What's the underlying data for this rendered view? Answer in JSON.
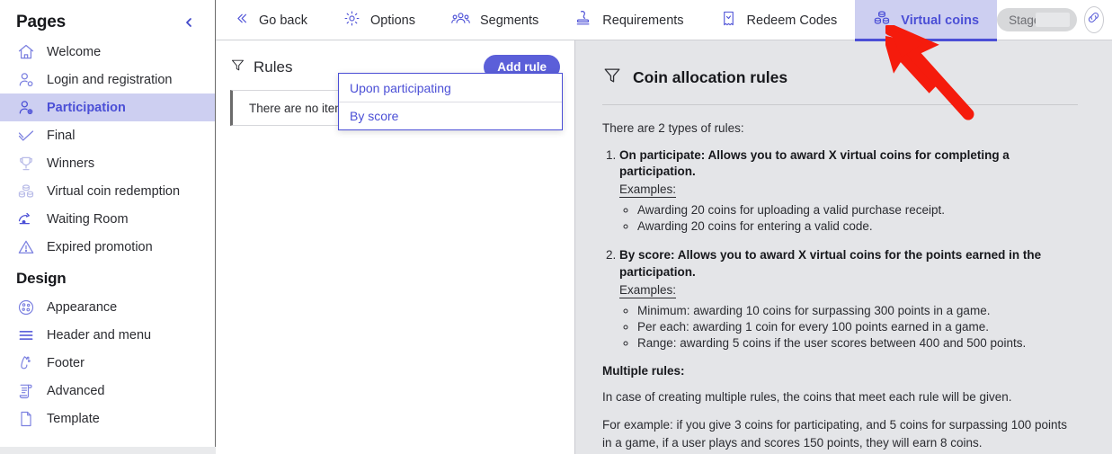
{
  "sidebar": {
    "title": "Pages",
    "collapse_icon": "chevron-left-icon",
    "pages": [
      {
        "label": "Welcome",
        "icon": "home-icon",
        "active": false
      },
      {
        "label": "Login and registration",
        "icon": "user-check-icon",
        "active": false
      },
      {
        "label": "Participation",
        "icon": "user-plus-icon",
        "active": true
      },
      {
        "label": "Final",
        "icon": "check-badge-icon",
        "active": false
      },
      {
        "label": "Winners",
        "icon": "trophy-icon",
        "active": false
      },
      {
        "label": "Virtual coin redemption",
        "icon": "coins-stack-icon",
        "active": false
      },
      {
        "label": "Waiting Room",
        "icon": "waiting-room-icon",
        "active": false
      },
      {
        "label": "Expired promotion",
        "icon": "warning-triangle-icon",
        "active": false
      }
    ],
    "design_title": "Design",
    "design": [
      {
        "label": "Appearance",
        "icon": "palette-icon"
      },
      {
        "label": "Header and menu",
        "icon": "menu-lines-icon"
      },
      {
        "label": "Footer",
        "icon": "footer-icon"
      },
      {
        "label": "Advanced",
        "icon": "scroll-document-icon"
      },
      {
        "label": "Template",
        "icon": "page-icon"
      }
    ]
  },
  "toolbar": {
    "items": [
      {
        "label": "Go back",
        "icon": "double-chevron-left-icon",
        "active": false
      },
      {
        "label": "Options",
        "icon": "gear-icon",
        "active": false
      },
      {
        "label": "Segments",
        "icon": "people-group-icon",
        "active": false
      },
      {
        "label": "Requirements",
        "icon": "stamp-icon",
        "active": false
      },
      {
        "label": "Redeem Codes",
        "icon": "ticket-icon",
        "active": false
      },
      {
        "label": "Virtual coins",
        "icon": "coins-stack-icon",
        "active": true
      }
    ],
    "stage_label": "Stage #",
    "link_icon": "link-icon"
  },
  "rules_panel": {
    "title": "Rules",
    "title_icon": "filter-icon",
    "add_button": "Add rule",
    "empty_message": "There are no items",
    "dropdown": {
      "options": [
        {
          "label": "Upon participating"
        },
        {
          "label": "By score"
        }
      ]
    }
  },
  "info_panel": {
    "title": "Coin allocation rules",
    "title_icon": "filter-icon",
    "lead": "There are 2 types of rules:",
    "types": [
      {
        "title": "On participate: Allows you to award X virtual coins for completing a participation.",
        "examples_label": "Examples:",
        "examples": [
          "Awarding 20 coins for uploading a valid purchase receipt.",
          "Awarding 20 coins for entering a valid code."
        ]
      },
      {
        "title": "By score: Allows you to award X virtual coins for the points earned in the participation.",
        "examples_label": "Examples:",
        "examples": [
          "Minimum: awarding 10 coins for surpassing 300 points in a game.",
          "Per each: awarding 1 coin for every 100 points earned in a game.",
          "Range: awarding 5 coins if the user scores between 400 and 500 points."
        ]
      }
    ],
    "multiple_title": "Multiple rules:",
    "multiple_p1": "In case of creating multiple rules, the coins that meet each rule will be given.",
    "multiple_p2": "For example: if you give 3 coins for participating, and 5 coins for surpassing 100 points in a game, if a user plays and scores 150 points, they will earn 8 coins."
  },
  "annotation": {
    "arrow_icon": "red-arrow-annotation",
    "arrow_color": "#f51b0c"
  },
  "colors": {
    "accent": "#4b4fd6",
    "accent_button": "#5b5fd9",
    "active_tab_bg": "#cdcff1",
    "info_bg": "#e4e5e8"
  }
}
